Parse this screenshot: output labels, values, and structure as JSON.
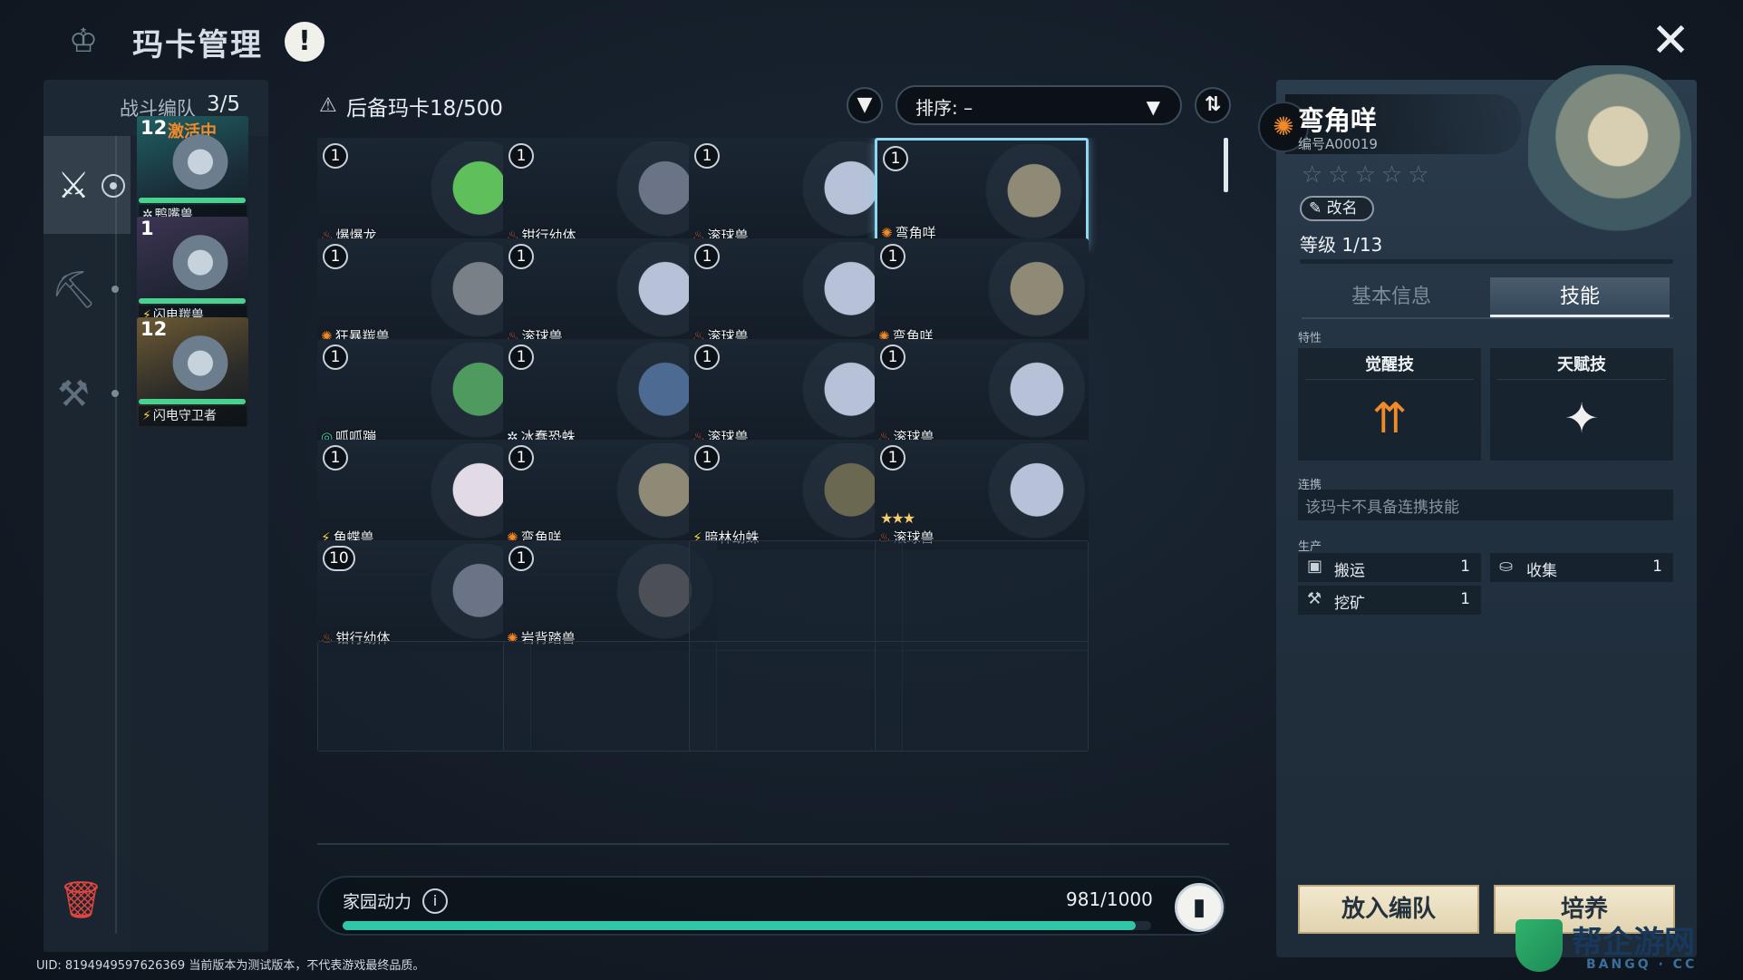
{
  "header": {
    "title": "玛卡管理",
    "alert": "!"
  },
  "sidebar": {
    "team_label": "战斗编队",
    "team_count": "3/5",
    "team": [
      {
        "level": "12",
        "active": "激活中",
        "element_icon": "ice-icon",
        "element": "✲",
        "name": "鸭嘴兽",
        "hp": 1.0,
        "tone": "teal"
      },
      {
        "level": "1",
        "active": "",
        "element_icon": "lightning-icon",
        "element": "⚡",
        "name": "闪电羰兽",
        "hp": 1.0,
        "tone": "violet"
      },
      {
        "level": "12",
        "active": "",
        "element_icon": "lightning-icon",
        "element": "⚡",
        "name": "闪电守卫者",
        "hp": 1.0,
        "tone": "gold"
      }
    ]
  },
  "grid": {
    "title": "后备玛卡18/500",
    "sort_label": "排序: –",
    "cards": [
      {
        "level": "1",
        "element_icon": "fire-icon",
        "element": "♨",
        "name": "爆爆龙",
        "color": "#5fbf5a"
      },
      {
        "level": "1",
        "element_icon": "fire-icon",
        "element": "♨",
        "name": "钳行幼体",
        "color": "#6a7486"
      },
      {
        "level": "1",
        "element_icon": "fire-icon",
        "element": "♨",
        "name": "滚球兽",
        "color": "#b7c2d8"
      },
      {
        "level": "1",
        "element_icon": "gear-icon",
        "element": "✺",
        "name": "弯角咩",
        "color": "#8e8a76",
        "selected": true
      },
      {
        "level": "1",
        "element_icon": "gear-icon",
        "element": "✺",
        "name": "狂暴羰兽",
        "color": "#7a8088"
      },
      {
        "level": "1",
        "element_icon": "fire-icon",
        "element": "♨",
        "name": "滚球兽",
        "color": "#b7c2d8"
      },
      {
        "level": "1",
        "element_icon": "fire-icon",
        "element": "♨",
        "name": "滚球兽",
        "color": "#b7c2d8"
      },
      {
        "level": "1",
        "element_icon": "gear-icon",
        "element": "✺",
        "name": "弯角咩",
        "color": "#8e8a76"
      },
      {
        "level": "1",
        "element_icon": "wind-icon",
        "element": "◎",
        "name": "呱呱蹦",
        "color": "#4f9a5f"
      },
      {
        "level": "1",
        "element_icon": "ice-icon",
        "element": "✲",
        "name": "冰蠢恐蛛",
        "color": "#4d6b92"
      },
      {
        "level": "1",
        "element_icon": "fire-icon",
        "element": "♨",
        "name": "滚球兽",
        "color": "#b7c2d8"
      },
      {
        "level": "1",
        "element_icon": "fire-icon",
        "element": "♨",
        "name": "滚球兽",
        "color": "#b7c2d8"
      },
      {
        "level": "1",
        "element_icon": "lightning-icon",
        "element": "⚡",
        "name": "角蝶兽",
        "color": "#e2dbe6"
      },
      {
        "level": "1",
        "element_icon": "gear-icon",
        "element": "✺",
        "name": "弯角咩",
        "color": "#8e8a76"
      },
      {
        "level": "1",
        "element_icon": "lightning-icon",
        "element": "⚡",
        "name": "暗林幼蛛",
        "color": "#6b6852"
      },
      {
        "level": "1",
        "element_icon": "fire-icon",
        "element": "♨",
        "name": "滚球兽",
        "color": "#b7c2d8",
        "stars": "★★★"
      },
      {
        "level": "10",
        "element_icon": "fire-icon",
        "element": "♨",
        "name": "钳行幼体",
        "color": "#6a7486"
      },
      {
        "level": "1",
        "element_icon": "gear-icon",
        "element": "✺",
        "name": "岩背踏兽",
        "color": "#4c4f55"
      }
    ],
    "empty_slots": 6
  },
  "home": {
    "label": "家园动力",
    "value": "981/1000",
    "progress": 0.981
  },
  "detail": {
    "name": "弯角咩",
    "code": "编号A00019",
    "stars": "☆☆☆☆☆",
    "rename": "改名",
    "level": "等级 1/13",
    "tabs": {
      "basic": "基本信息",
      "skills": "技能"
    },
    "trait_label": "特性",
    "awaken": "觉醒技",
    "talent": "天赋技",
    "link_label": "连携",
    "link_text": "该玛卡不具备连携技能",
    "prod_label": "生产",
    "production": [
      {
        "icon": "box-icon",
        "glyph": "▣",
        "label": "搬运",
        "value": "1"
      },
      {
        "icon": "basket-icon",
        "glyph": "⛀",
        "label": "收集",
        "value": "1"
      },
      {
        "icon": "pickaxe-icon",
        "glyph": "⚒",
        "label": "挖矿",
        "value": "1"
      }
    ],
    "btn_team": "放入编队",
    "btn_train": "培养"
  },
  "footer": "UID: 8194949597626369 当前版本为测试版本，不代表游戏最终品质。",
  "watermark": {
    "text": "帮企游网",
    "sub": "BANGQ · CC"
  },
  "colors": {
    "accent_fire": "#f08a2a",
    "hp_green": "#48d28e",
    "home_bar": "#2fc6a9",
    "delete_red": "#e0453e"
  }
}
